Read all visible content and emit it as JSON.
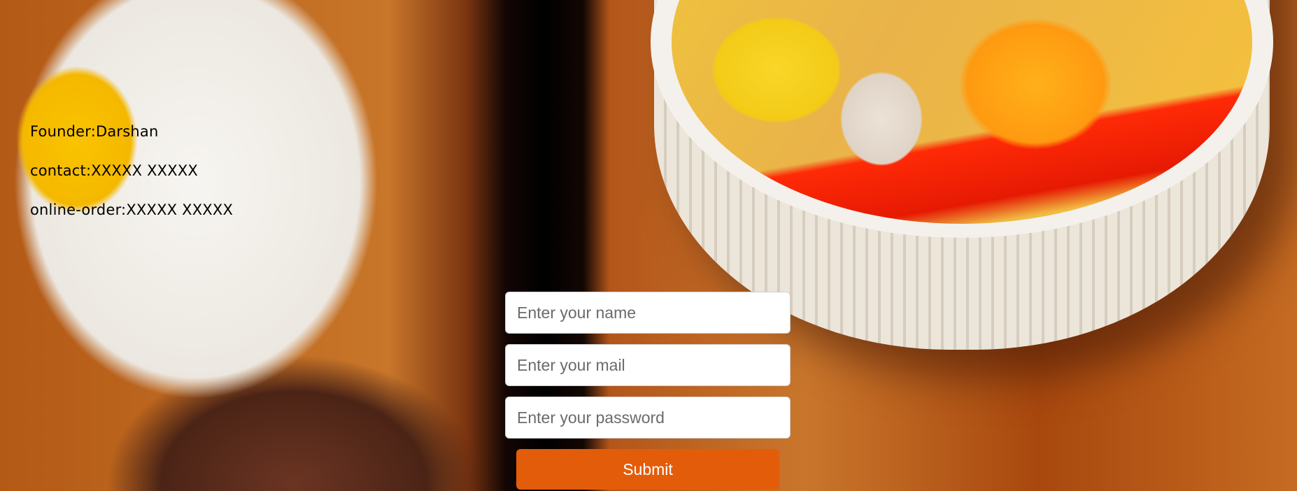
{
  "info": {
    "founder": "Founder:Darshan",
    "contact": "contact:XXXXX XXXXX",
    "online_order": "online-order:XXXXX XXXXX"
  },
  "form": {
    "name_placeholder": "Enter your name",
    "mail_placeholder": "Enter your mail",
    "password_placeholder": "Enter your password",
    "submit_label": "Submit"
  },
  "colors": {
    "submit_button": "#e35c0a"
  }
}
